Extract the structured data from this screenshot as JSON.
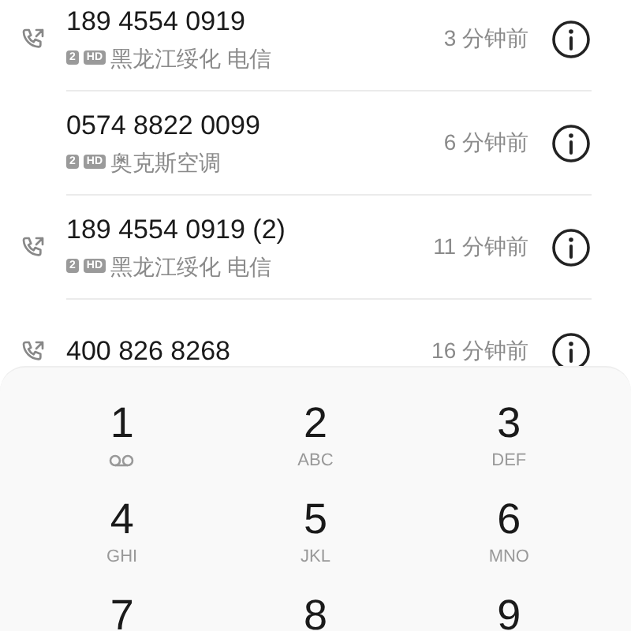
{
  "calls": [
    {
      "number": "189 4554 0919",
      "outgoing": true,
      "sim": "2",
      "hd": "HD",
      "location": "黑龙江绥化 电信",
      "time": "3 分钟前"
    },
    {
      "number": "0574 8822 0099",
      "outgoing": false,
      "sim": "2",
      "hd": "HD",
      "location": "奥克斯空调",
      "time": "6 分钟前"
    },
    {
      "number": "189 4554 0919 (2)",
      "outgoing": true,
      "sim": "2",
      "hd": "HD",
      "location": "黑龙江绥化 电信",
      "time": "11 分钟前"
    },
    {
      "number": "400 826 8268",
      "outgoing": true,
      "time": "16 分钟前"
    }
  ],
  "dialpad": {
    "keys": [
      {
        "digit": "1",
        "kind": "voicemail"
      },
      {
        "digit": "2",
        "kind": "letters",
        "letters": "ABC"
      },
      {
        "digit": "3",
        "kind": "letters",
        "letters": "DEF"
      },
      {
        "digit": "4",
        "kind": "letters",
        "letters": "GHI"
      },
      {
        "digit": "5",
        "kind": "letters",
        "letters": "JKL"
      },
      {
        "digit": "6",
        "kind": "letters",
        "letters": "MNO"
      },
      {
        "digit": "7",
        "kind": "plain"
      },
      {
        "digit": "8",
        "kind": "plain"
      },
      {
        "digit": "9",
        "kind": "plain"
      }
    ]
  }
}
